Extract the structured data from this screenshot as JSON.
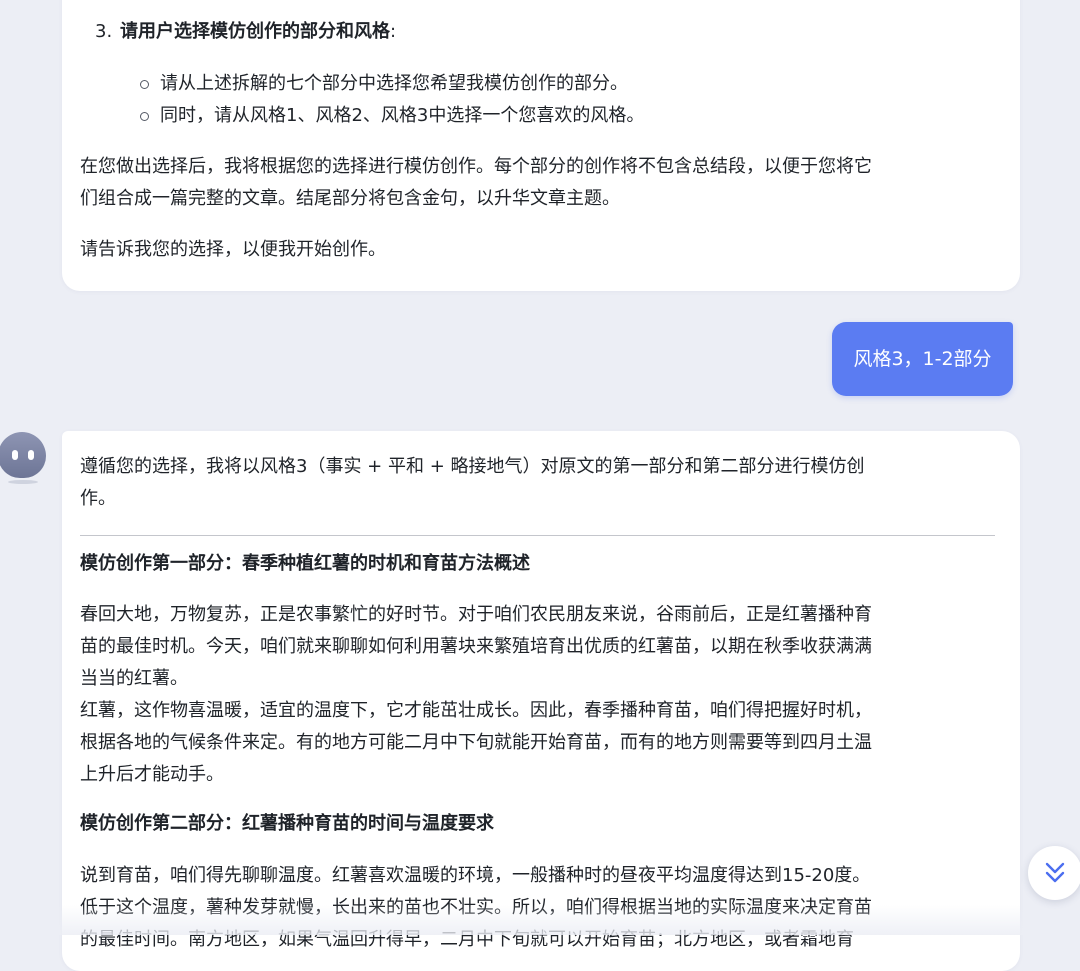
{
  "prev_message": {
    "list_item_number": "3.",
    "list_item_title": "请用户选择模仿创作的部分和风格",
    "list_item_colon": ":",
    "sub_items": [
      "请从上述拆解的七个部分中选择您希望我模仿创作的部分。",
      "同时，请从风格1、风格2、风格3中选择一个您喜欢的风格。"
    ],
    "paragraph_1_lines": [
      "在您做出选择后，我将根据您的选择进行模仿创作。每个部分的创作将不包含总结段，以便于您将它",
      "们组合成一篇完整的文章。结尾部分将包含金句，以升华文章主题。"
    ],
    "paragraph_2": "请告诉我您的选择，以便我开始创作。"
  },
  "user_message": {
    "text": "风格3，1-2部分"
  },
  "ai_message": {
    "intro_lines": [
      "遵循您的选择，我将以风格3（事实 + 平和 + 略接地气）对原文的第一部分和第二部分进行模仿创",
      "作。"
    ],
    "section_1_heading": "模仿创作第一部分：春季种植红薯的时机和育苗方法概述",
    "section_1_lines": [
      "春回大地，万物复苏，正是农事繁忙的好时节。对于咱们农民朋友来说，谷雨前后，正是红薯播种育",
      "苗的最佳时机。今天，咱们就来聊聊如何利用薯块来繁殖培育出优质的红薯苗，以期在秋季收获满满",
      "当当的红薯。",
      "红薯，这作物喜温暖，适宜的温度下，它才能茁壮成长。因此，春季播种育苗，咱们得把握好时机，",
      "根据各地的气候条件来定。有的地方可能二月中下旬就能开始育苗，而有的地方则需要等到四月土温",
      "上升后才能动手。"
    ],
    "section_2_heading": "模仿创作第二部分：红薯播种育苗的时间与温度要求",
    "section_2_lines": [
      "说到育苗，咱们得先聊聊温度。红薯喜欢温暖的环境，一般播种时的昼夜平均温度得达到15-20度。",
      "低于这个温度，薯种发芽就慢，长出来的苗也不壮实。所以，咱们得根据当地的实际温度来决定育苗",
      "的最佳时间。南方地区，如果气温回升得早，二月中下旬就可以开始育苗；北方地区，或者霜地育"
    ]
  },
  "icons": {
    "avatar": "bot-avatar-icon",
    "scroll_down": "double-chevron-down-icon"
  },
  "colors": {
    "user_bubble": "#5b7cf2",
    "background": "#eceef5",
    "accent_icon": "#4b6ef0"
  }
}
